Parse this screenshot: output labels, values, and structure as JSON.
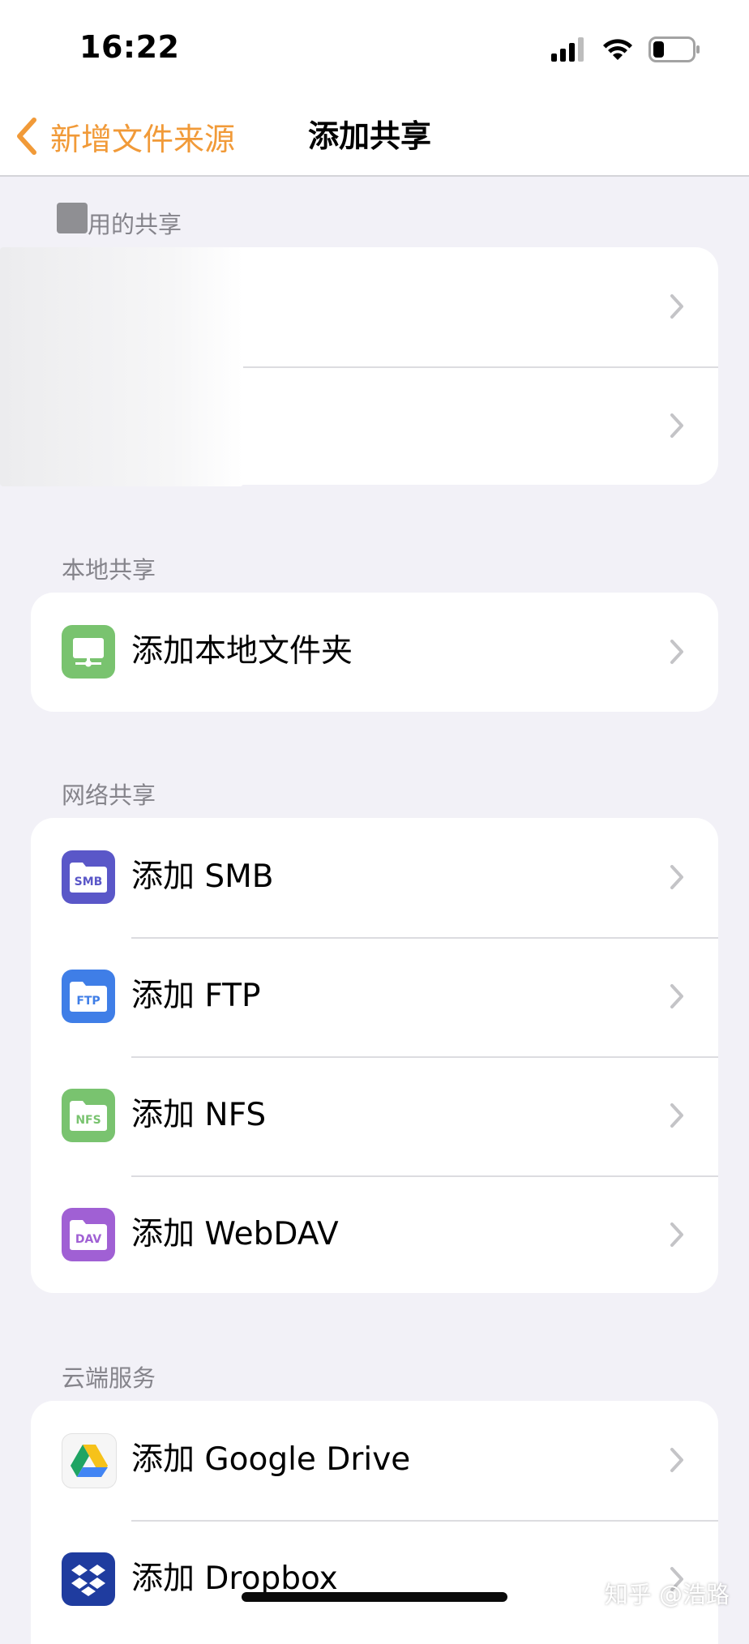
{
  "status_bar": {
    "time": "16:22"
  },
  "nav": {
    "back_label": "新增文件来源",
    "title": "添加共享"
  },
  "sections": {
    "recent": {
      "header": "用的共享"
    },
    "local": {
      "header": "本地共享",
      "rows": [
        {
          "label": "添加本地文件夹",
          "icon": "local-folder-icon"
        }
      ]
    },
    "network": {
      "header": "网络共享",
      "rows": [
        {
          "label": "添加 SMB",
          "icon_text": "SMB",
          "color": "#5a57c8"
        },
        {
          "label": "添加 FTP",
          "icon_text": "FTP",
          "color": "#3f7ee7"
        },
        {
          "label": "添加 NFS",
          "icon_text": "NFS",
          "color": "#79c36f"
        },
        {
          "label": "添加 WebDAV",
          "icon_text": "DAV",
          "color": "#a060d4"
        }
      ]
    },
    "cloud": {
      "header": "云端服务",
      "rows": [
        {
          "label": "添加 Google Drive",
          "icon": "google-drive-icon"
        },
        {
          "label": "添加 Dropbox",
          "icon": "dropbox-icon",
          "color": "#1f3c9f"
        }
      ]
    }
  },
  "watermark": "知乎 @浩路",
  "colors": {
    "accent": "#f19a38",
    "background": "#f2f1f7",
    "green_icon": "#79c36f"
  }
}
